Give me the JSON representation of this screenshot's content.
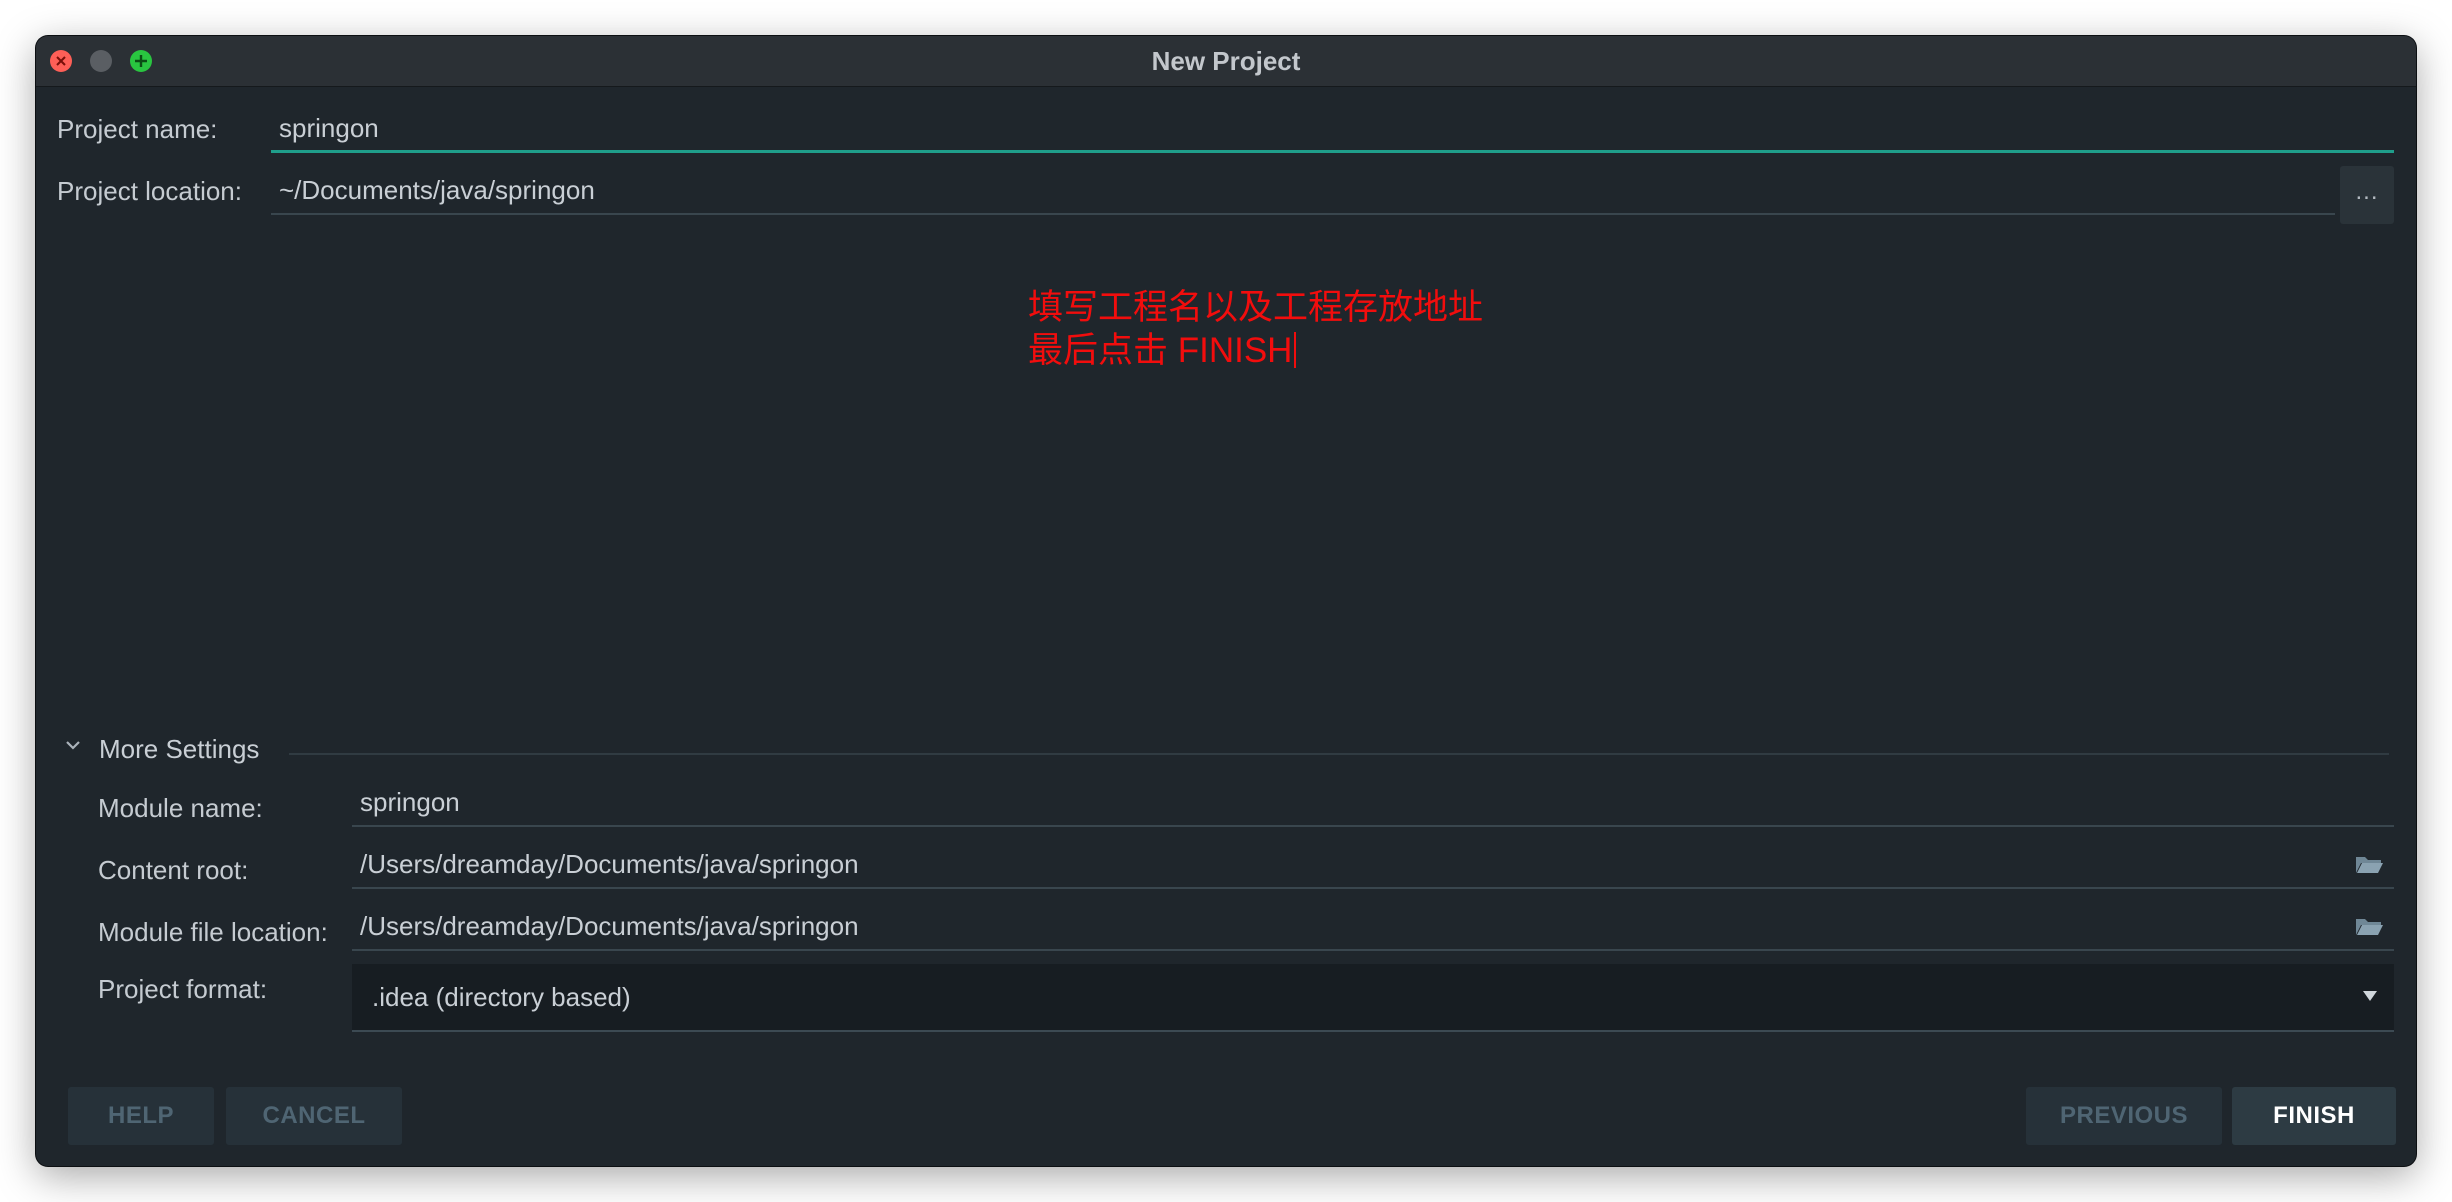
{
  "window": {
    "title": "New Project"
  },
  "project": {
    "name_label": "Project name:",
    "name_value": "springon",
    "location_label": "Project location:",
    "location_value": "~/Documents/java/springon",
    "browse_label": "..."
  },
  "annotation": {
    "line1": "填写工程名以及工程存放地址",
    "line2": "最后点击 FINISH"
  },
  "more_settings": {
    "title": "More Settings",
    "module_name_label": "Module name:",
    "module_name_value": "springon",
    "content_root_label": "Content root:",
    "content_root_value": "/Users/dreamday/Documents/java/springon",
    "module_file_label": "Module file location:",
    "module_file_value": "/Users/dreamday/Documents/java/springon",
    "format_label": "Project format:",
    "format_value": ".idea (directory based)"
  },
  "buttons": {
    "help": "HELP",
    "cancel": "CANCEL",
    "previous": "PREVIOUS",
    "finish": "FINISH"
  },
  "colors": {
    "window_bg": "#1f262c",
    "focus_accent": "#1f9e8b",
    "annotation": "#f20d0d"
  },
  "icons": [
    "close-icon",
    "minimize-icon",
    "maximize-icon",
    "chevron-down-icon",
    "folder-icon",
    "dropdown-arrow-icon"
  ]
}
